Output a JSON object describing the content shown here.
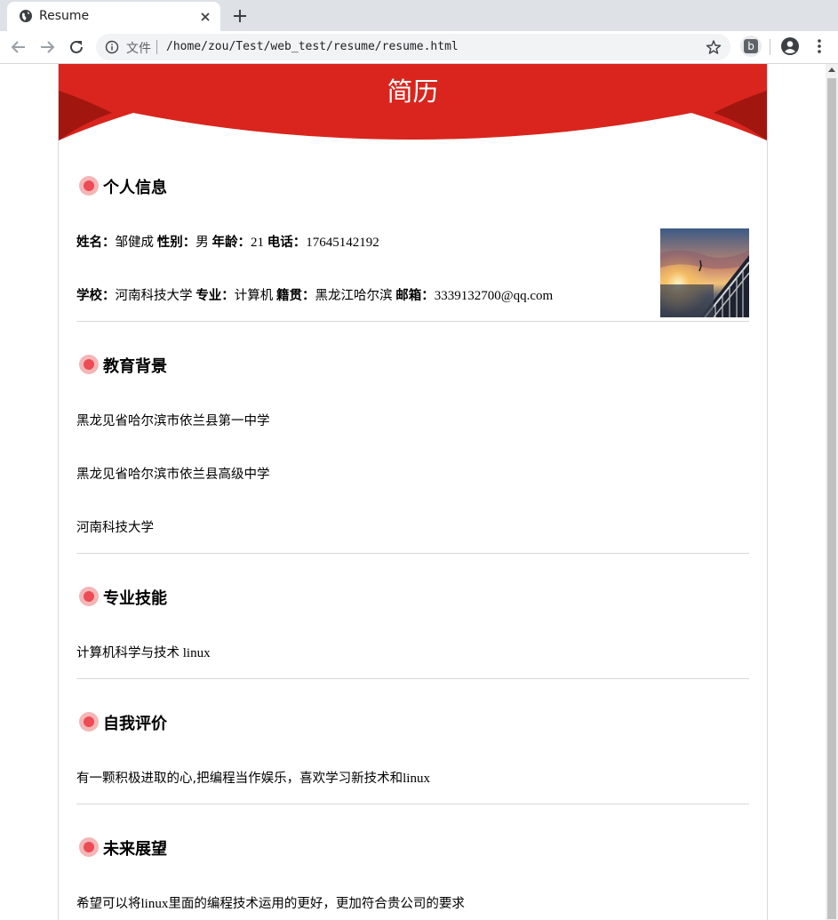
{
  "browser": {
    "tab_title": "Resume",
    "file_label": "文件",
    "url": "/home/zou/Test/web_test/resume/resume.html",
    "extension_letter": "b"
  },
  "page": {
    "banner_title": "简历",
    "accent_color": "#d9251d",
    "sections": {
      "personal": {
        "title": "个人信息",
        "name_label": "姓名：",
        "name_value": "邹健成",
        "gender_label": "性别：",
        "gender_value": "男",
        "age_label": "年龄：",
        "age_value": "21",
        "phone_label": "电话：",
        "phone_value": "17645142192",
        "school_label": "学校：",
        "school_value": "河南科技大学",
        "major_label": "专业：",
        "major_value": "计算机",
        "origin_label": "籍贯：",
        "origin_value": "黑龙江哈尔滨",
        "email_label": "邮箱：",
        "email_value": "3339132700@qq.com"
      },
      "education": {
        "title": "教育背景",
        "items": [
          "黑龙见省哈尔滨市依兰县第一中学",
          "黑龙见省哈尔滨市依兰县高级中学",
          "河南科技大学"
        ]
      },
      "skills": {
        "title": "专业技能",
        "text_cjk": "计算机科学与技术",
        "text_latin": " linux"
      },
      "self_eval": {
        "title": "自我评价",
        "text_cjk": "有一颗积极进取的心,把编程当作娱乐，喜欢学习新技术和",
        "text_latin": "linux"
      },
      "future": {
        "title": "未来展望",
        "text_cjk_1": "希望可以将",
        "text_latin": "linux",
        "text_cjk_2": "里面的编程技术运用的更好，更加符合贵公司的要求"
      }
    }
  }
}
